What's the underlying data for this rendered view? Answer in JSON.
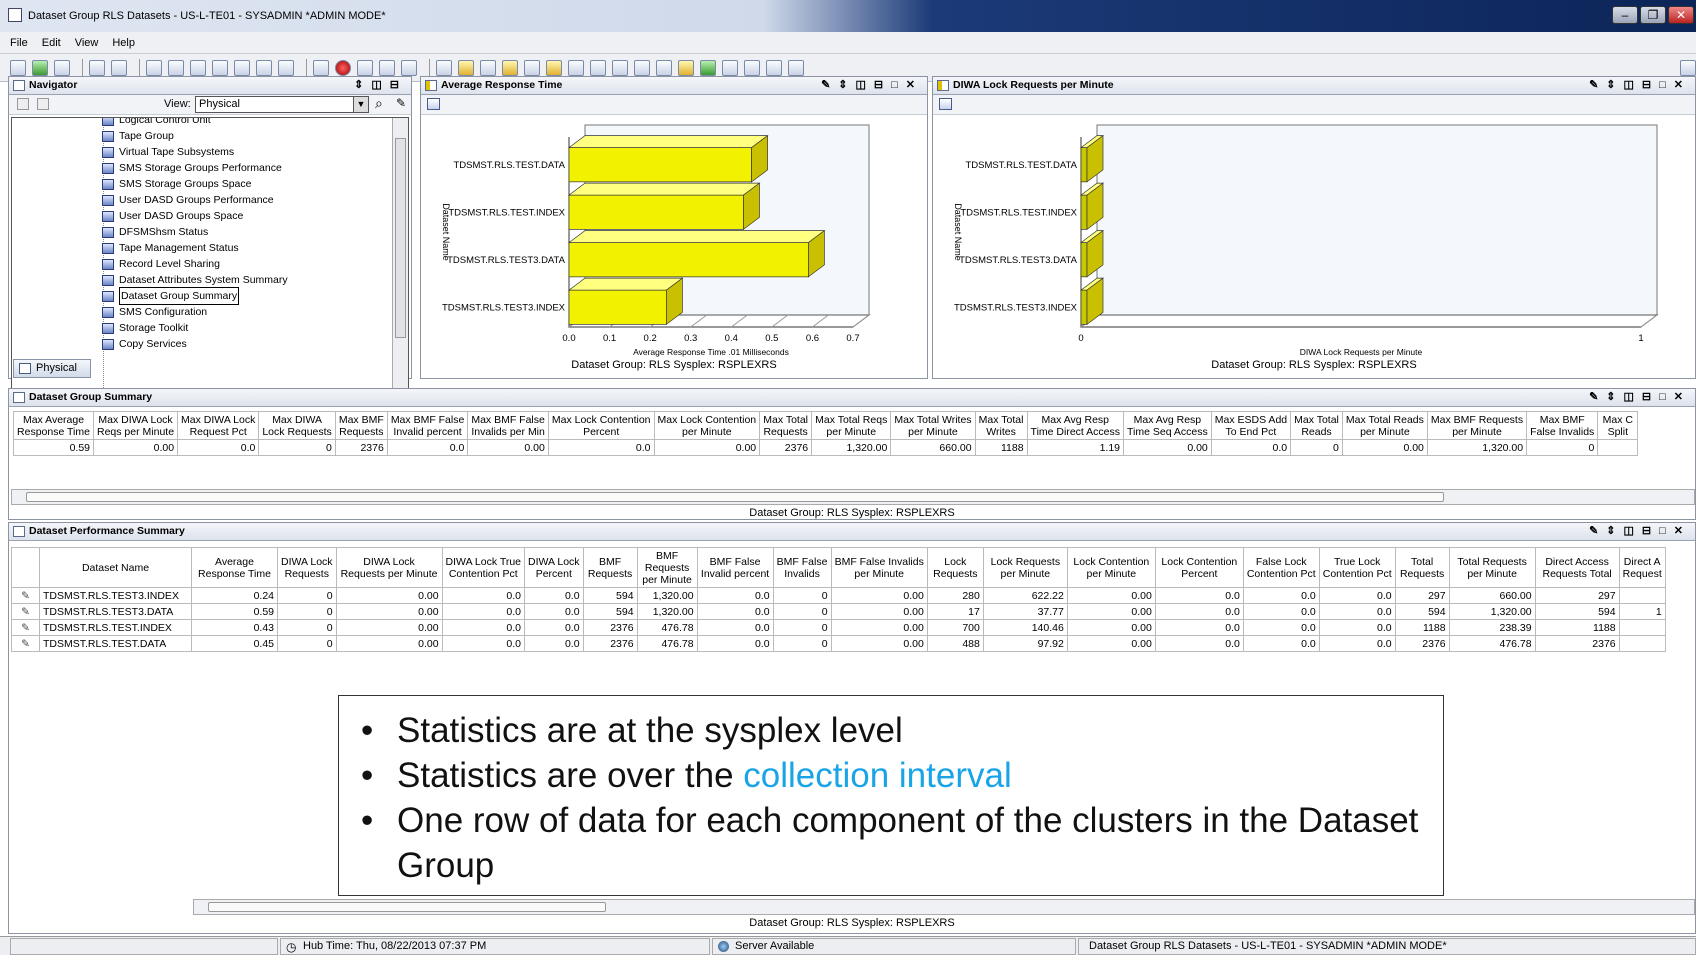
{
  "window": {
    "title": "Dataset Group RLS Datasets - US-L-TE01 - SYSADMIN  *ADMIN MODE*"
  },
  "menu": [
    "File",
    "Edit",
    "View",
    "Help"
  ],
  "navigator": {
    "title": "Navigator",
    "view_label": "View:",
    "view_value": "Physical",
    "tab": "Physical",
    "items": [
      "Logical Control Unit",
      "Tape Group",
      "Virtual Tape Subsystems",
      "SMS Storage Groups Performance",
      "SMS Storage Groups Space",
      "User DASD Groups Performance",
      "User DASD Groups Space",
      "DFSMShsm Status",
      "Tape Management Status",
      "Record Level Sharing",
      "Dataset Attributes System Summary",
      "Dataset Group Summary",
      "SMS Configuration",
      "Storage Toolkit",
      "Copy Services"
    ],
    "selected": "Dataset Group Summary"
  },
  "chart_panels": {
    "avg_title": "Average Response Time",
    "diwa_title": "DIWA Lock Requests per Minute",
    "footer": "Dataset Group:  RLS   Sysplex: RSPLEXRS"
  },
  "chart_data": [
    {
      "type": "bar",
      "orientation": "horizontal",
      "categories": [
        "TDSMST.RLS.TEST.DATA",
        "TDSMST.RLS.TEST.INDEX",
        "TDSMST.RLS.TEST3.DATA",
        "TDSMST.RLS.TEST3.INDEX"
      ],
      "values": [
        0.45,
        0.43,
        0.59,
        0.24
      ],
      "xlabel": "Average Response Time .01 Milliseconds",
      "ylabel": "Dataset Name",
      "xticks": [
        "0.0",
        "0.1",
        "0.2",
        "0.3",
        "0.4",
        "0.5",
        "0.6",
        "0.7"
      ],
      "xlim": [
        0,
        0.7
      ],
      "color": "#f2f200"
    },
    {
      "type": "bar",
      "orientation": "horizontal",
      "categories": [
        "TDSMST.RLS.TEST.DATA",
        "TDSMST.RLS.TEST.INDEX",
        "TDSMST.RLS.TEST3.DATA",
        "TDSMST.RLS.TEST3.INDEX"
      ],
      "values": [
        0,
        0,
        0,
        0
      ],
      "xlabel": "DIWA Lock Requests per Minute",
      "ylabel": "Dataset Name",
      "xticks": [
        "0",
        "1"
      ],
      "xlim": [
        0,
        1
      ],
      "color": "#c8c800"
    }
  ],
  "summary": {
    "title": "Dataset Group Summary",
    "footer": "Dataset Group:  RLS   Sysplex: RSPLEXRS",
    "columns": [
      "Max Average|Response Time",
      "Max DIWA Lock|Reqs per Minute",
      "Max DIWA Lock|Request Pct",
      "Max DIWA|Lock Requests",
      "Max BMF|Requests",
      "Max BMF False|Invalid percent",
      "Max BMF False|Invalids per Min",
      "Max Lock Contention|Percent",
      "Max Lock Contention|per Minute",
      "Max Total|Requests",
      "Max Total Reqs|per Minute",
      "Max Total Writes|per Minute",
      "Max Total|Writes",
      "Max Avg Resp|Time Direct Access",
      "Max Avg Resp|Time Seq Access",
      "Max ESDS Add|To End Pct",
      "Max Total|Reads",
      "Max Total Reads|per Minute",
      "Max BMF Requests|per Minute",
      "Max BMF|False Invalids",
      "Max C|Split"
    ],
    "row": [
      "0.59",
      "0.00",
      "0.0",
      "0",
      "2376",
      "0.0",
      "0.00",
      "0.0",
      "0.00",
      "2376",
      "1,320.00",
      "660.00",
      "1188",
      "1.19",
      "0.00",
      "0.0",
      "0",
      "0.00",
      "1,320.00",
      "0",
      ""
    ]
  },
  "performance": {
    "title": "Dataset Performance Summary",
    "footer": "Dataset Group:  RLS   Sysplex: RSPLEXRS",
    "columns": [
      "",
      "Dataset Name",
      "Average|Response Time",
      "DIWA Lock|Requests",
      "DIWA Lock|Requests per Minute",
      "DIWA Lock True|Contention Pct",
      "DIWA Lock|Percent",
      "BMF|Requests",
      "BMF|Requests|per Minute",
      "BMF False|Invalid percent",
      "BMF False|Invalids",
      "BMF False Invalids|per Minute",
      "Lock|Requests",
      "Lock Requests|per Minute",
      "Lock Contention|per Minute",
      "Lock Contention|Percent",
      "False Lock|Contention Pct",
      "True Lock|Contention Pct",
      "Total|Requests",
      "Total Requests|per Minute",
      "Direct Access|Requests Total",
      "Direct A|Request"
    ],
    "rows": [
      [
        "",
        "TDSMST.RLS.TEST3.INDEX",
        "0.24",
        "0",
        "0.00",
        "0.0",
        "0.0",
        "594",
        "1,320.00",
        "0.0",
        "0",
        "0.00",
        "280",
        "622.22",
        "0.00",
        "0.0",
        "0.0",
        "0.0",
        "297",
        "660.00",
        "297",
        ""
      ],
      [
        "",
        "TDSMST.RLS.TEST3.DATA",
        "0.59",
        "0",
        "0.00",
        "0.0",
        "0.0",
        "594",
        "1,320.00",
        "0.0",
        "0",
        "0.00",
        "17",
        "37.77",
        "0.00",
        "0.0",
        "0.0",
        "0.0",
        "594",
        "1,320.00",
        "594",
        "1"
      ],
      [
        "",
        "TDSMST.RLS.TEST.INDEX",
        "0.43",
        "0",
        "0.00",
        "0.0",
        "0.0",
        "2376",
        "476.78",
        "0.0",
        "0",
        "0.00",
        "700",
        "140.46",
        "0.00",
        "0.0",
        "0.0",
        "0.0",
        "1188",
        "238.39",
        "1188",
        ""
      ],
      [
        "",
        "TDSMST.RLS.TEST.DATA",
        "0.45",
        "0",
        "0.00",
        "0.0",
        "0.0",
        "2376",
        "476.78",
        "0.0",
        "0",
        "0.00",
        "488",
        "97.92",
        "0.00",
        "0.0",
        "0.0",
        "0.0",
        "2376",
        "476.78",
        "2376",
        ""
      ]
    ]
  },
  "note": {
    "b1": "Statistics are at the sysplex level",
    "b2_pre": "Statistics are over the ",
    "b2_accent": "collection interval",
    "b3": "One row of data for each component of the clusters in the Dataset Group"
  },
  "status": {
    "hub_time": "Hub Time: Thu, 08/22/2013 07:37 PM",
    "server": "Server Available",
    "window": "Dataset Group RLS Datasets - US-L-TE01 - SYSADMIN  *ADMIN MODE*"
  }
}
